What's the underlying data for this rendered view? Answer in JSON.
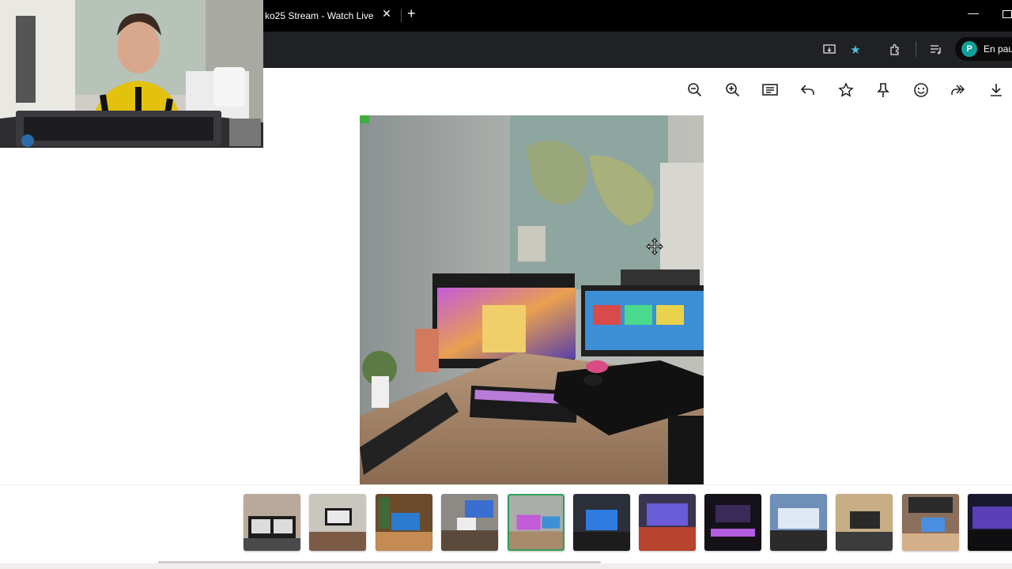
{
  "browser": {
    "tab_title": "ko25 Stream - Watch Live",
    "tab_close_icon": "close-icon",
    "new_tab_icon": "plus-icon",
    "profile_initial": "P",
    "profile_status": "En paus"
  },
  "viewer": {
    "toolbar": [
      {
        "name": "zoom-out-button",
        "icon": "zoom-out-icon"
      },
      {
        "name": "zoom-in-button",
        "icon": "zoom-in-icon"
      },
      {
        "name": "caption-button",
        "icon": "caption-icon"
      },
      {
        "name": "reply-button",
        "icon": "reply-icon"
      },
      {
        "name": "favorite-button",
        "icon": "star-icon"
      },
      {
        "name": "pin-button",
        "icon": "pin-icon"
      },
      {
        "name": "react-button",
        "icon": "smiley-icon"
      },
      {
        "name": "forward-button",
        "icon": "forward-icon"
      },
      {
        "name": "download-button",
        "icon": "download-icon"
      }
    ],
    "thumbnails_count_visible": 12,
    "selected_thumbnail": 5,
    "selected_color": "#2f9e5a"
  },
  "colors": {
    "tab_bar": "#000000",
    "address_bar": "#202124",
    "star_accent": "#4cc1e0",
    "avatar": "#129e9a"
  }
}
